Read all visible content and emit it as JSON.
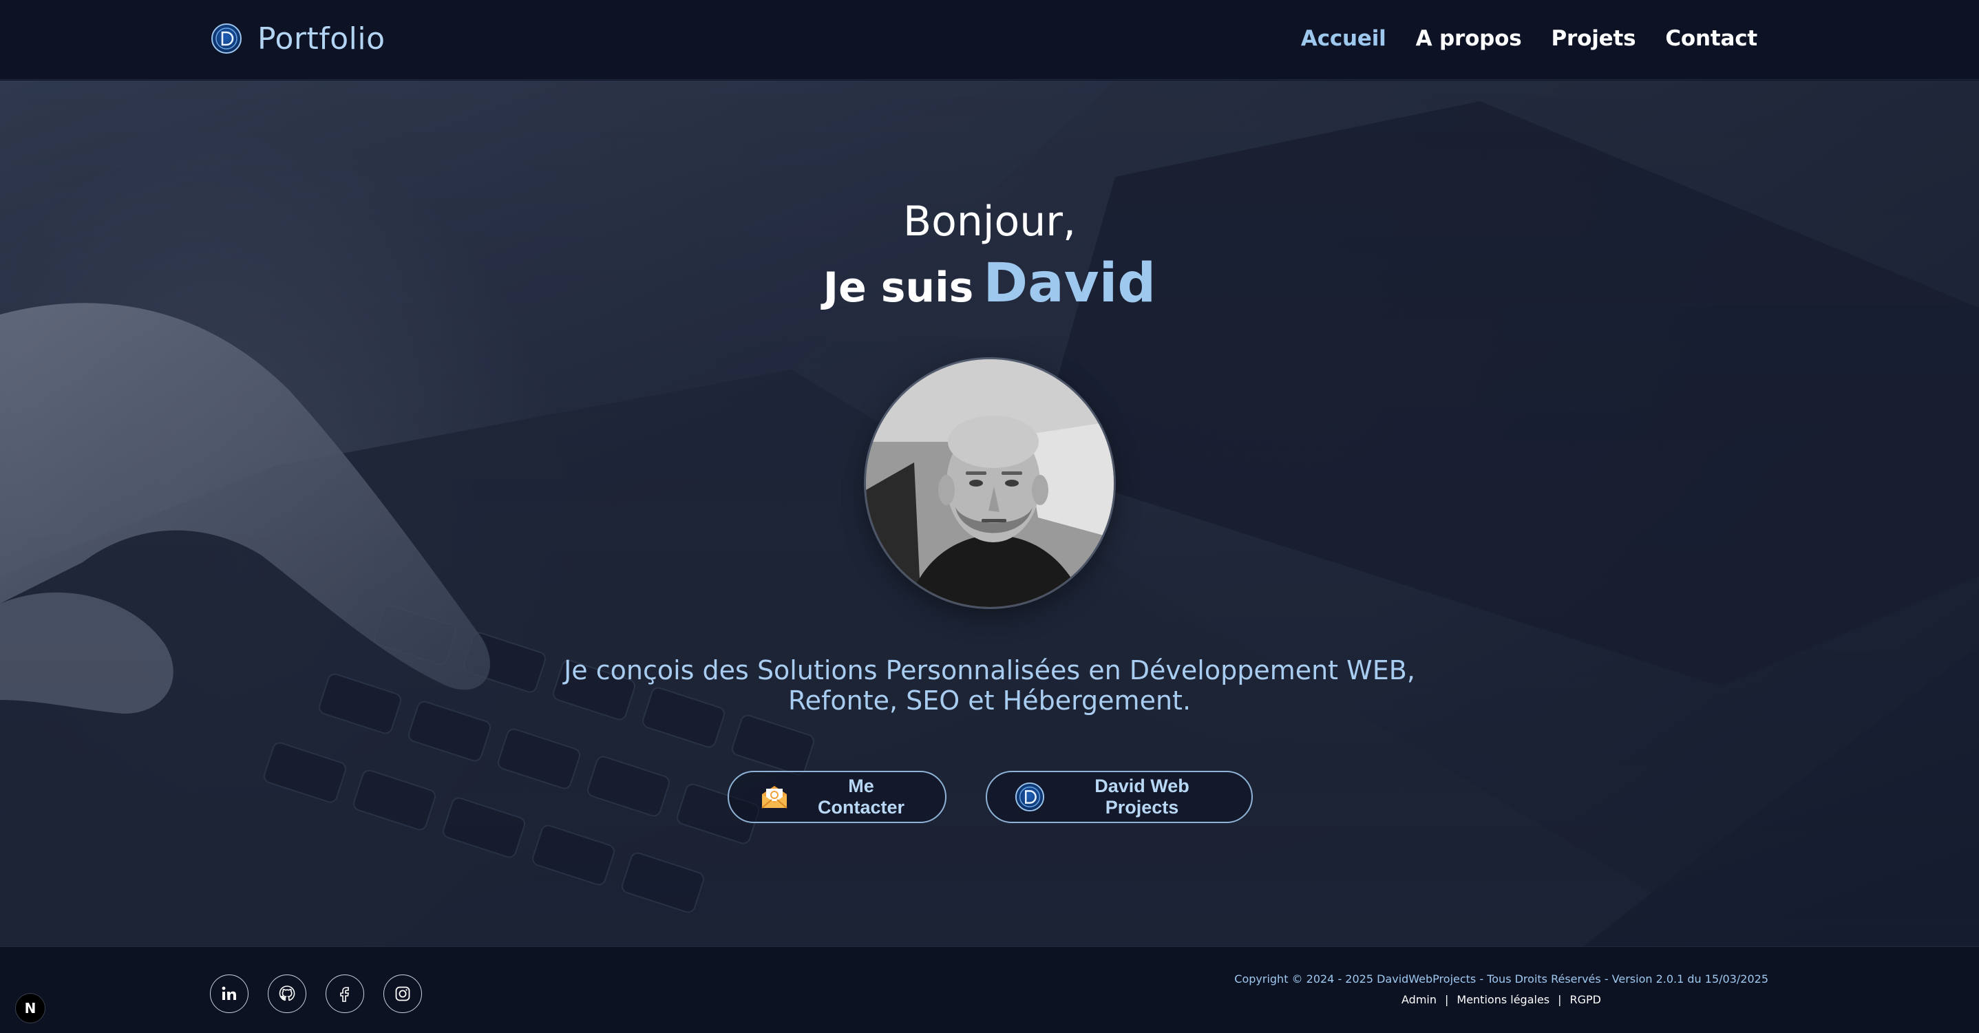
{
  "header": {
    "brand_name": "Portfolio",
    "nav": [
      {
        "label": "Accueil",
        "active": true
      },
      {
        "label": "A propos",
        "active": false
      },
      {
        "label": "Projets",
        "active": false
      },
      {
        "label": "Contact",
        "active": false
      }
    ]
  },
  "hero": {
    "greeting": "Bonjour,",
    "intro_prefix": "Je suis",
    "name": "David",
    "tagline_line1": "Je conçois des Solutions Personnalisées en Développement WEB,",
    "tagline_line2": "Refonte, SEO et Hébergement.",
    "contact_button_label": "Me Contacter",
    "projects_button_label": "David Web Projects",
    "contact_icon": "mail-icon",
    "projects_icon": "dwp-logo-icon"
  },
  "footer": {
    "socials": [
      "linkedin-icon",
      "github-icon",
      "facebook-icon",
      "instagram-icon"
    ],
    "copyright": "Copyright © 2024 - 2025 DavidWebProjects - Tous Droits Réservés - Version 2.0.1 du 15/03/2025",
    "links": [
      {
        "label": "Admin"
      },
      {
        "label": "Mentions légales"
      },
      {
        "label": "RGPD"
      }
    ],
    "link_separator": "|"
  },
  "dev_badge": "N",
  "colors": {
    "accent": "#9fc8ef",
    "header_bg": "#0d1324",
    "footer_bg": "#0c1222",
    "button_border": "#8fb3d6"
  }
}
